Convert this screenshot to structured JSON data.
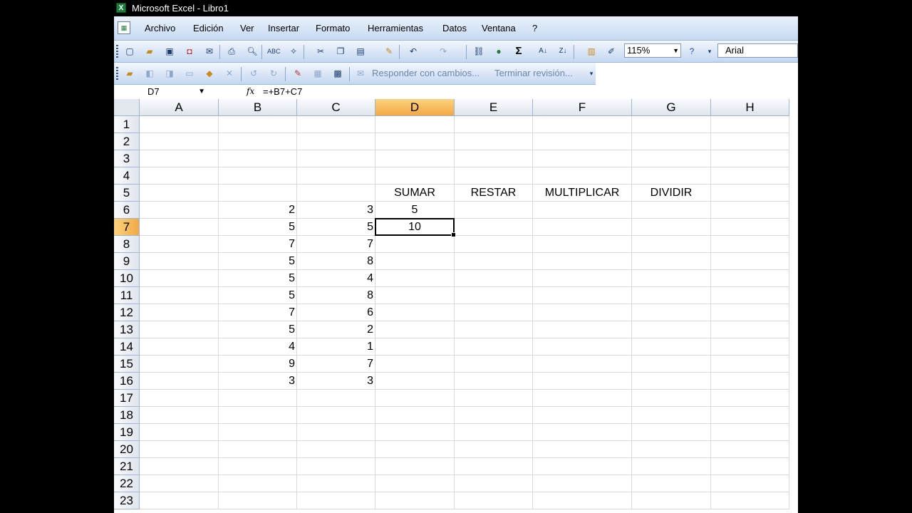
{
  "window": {
    "title": "Microsoft Excel - Libro1"
  },
  "menu": [
    "Archivo",
    "Edición",
    "Ver",
    "Insertar",
    "Formato",
    "Herramientas",
    "Datos",
    "Ventana",
    "?"
  ],
  "toolbar": {
    "zoom": "115%",
    "font": "Arial",
    "reply_changes": "Responder con cambios...",
    "end_review": "Terminar revisión..."
  },
  "formula_bar": {
    "name_box": "D7",
    "fx_label": "fx",
    "formula": "=+B7+C7"
  },
  "columns": [
    "A",
    "B",
    "C",
    "D",
    "E",
    "F",
    "G",
    "H"
  ],
  "rows": [
    "1",
    "2",
    "3",
    "4",
    "5",
    "6",
    "7",
    "8",
    "9",
    "10",
    "11",
    "12",
    "13",
    "14",
    "15",
    "16",
    "17",
    "18",
    "19",
    "20",
    "21",
    "22",
    "23"
  ],
  "cells": {
    "D5": "SUMAR",
    "E5": "RESTAR",
    "F5": "MULTIPLICAR",
    "G5": "DIVIDIR",
    "B6": "2",
    "C6": "3",
    "D6": "5",
    "B7": "5",
    "C7": "5",
    "D7": "10",
    "B8": "7",
    "C8": "7",
    "B9": "5",
    "C9": "8",
    "B10": "5",
    "C10": "4",
    "B11": "5",
    "C11": "8",
    "B12": "7",
    "C12": "6",
    "B13": "5",
    "C13": "2",
    "B14": "4",
    "C14": "1",
    "B15": "9",
    "C15": "7",
    "B16": "3",
    "C16": "3"
  },
  "active_cell": "D7"
}
